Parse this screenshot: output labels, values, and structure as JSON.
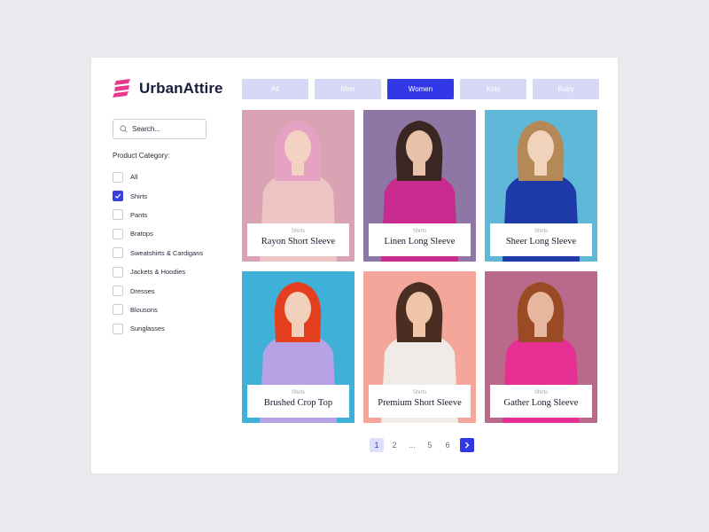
{
  "brand": {
    "name": "UrbanAttire",
    "accent": "#3238e6",
    "logo_color": "#e8398c"
  },
  "search": {
    "placeholder": "Search..."
  },
  "sidebar": {
    "category_title": "Product Category:",
    "categories": [
      {
        "label": "All",
        "checked": false
      },
      {
        "label": "Shirts",
        "checked": true
      },
      {
        "label": "Pants",
        "checked": false
      },
      {
        "label": "Bratops",
        "checked": false
      },
      {
        "label": "Sweatshirts & Cardigans",
        "checked": false
      },
      {
        "label": "Jackets & Hoodies",
        "checked": false
      },
      {
        "label": "Dresses",
        "checked": false
      },
      {
        "label": "Blousons",
        "checked": false
      },
      {
        "label": "Sunglasses",
        "checked": false
      }
    ]
  },
  "tabs": [
    {
      "label": "All",
      "active": false
    },
    {
      "label": "Men",
      "active": false
    },
    {
      "label": "Women",
      "active": true
    },
    {
      "label": "Kids",
      "active": false
    },
    {
      "label": "Baby",
      "active": false
    }
  ],
  "products": [
    {
      "category": "Shirts",
      "name": "Rayon Short Sleeve",
      "bg": "#d9a3b4",
      "shirt": "#eec3c3",
      "hair": "#e6a2c2",
      "skin": "#f3d2c4",
      "lower": "#e9d6d6"
    },
    {
      "category": "Shirts",
      "name": "Linen Long Sleeve",
      "bg": "#8e77a5",
      "shirt": "#c92a8e",
      "hair": "#3a2622",
      "skin": "#e7c2a8",
      "lower": "#c9d4df"
    },
    {
      "category": "Shirts",
      "name": "Sheer Long Sleeve",
      "bg": "#5fb8d8",
      "shirt": "#1d3aa8",
      "hair": "#b58858",
      "skin": "#f1d2ba",
      "lower": "#5a6e86"
    },
    {
      "category": "Shirts",
      "name": "Brushed Crop Top",
      "bg": "#3fb0d8",
      "shirt": "#b7a2e6",
      "hair": "#e4401f",
      "skin": "#f1d0bc",
      "lower": "#2c3a55"
    },
    {
      "category": "Shirts",
      "name": "Premium Short Sleeve",
      "bg": "#f4a69a",
      "shirt": "#f0ebe6",
      "hair": "#4a2e22",
      "skin": "#efc4a8",
      "lower": "#f39cbd"
    },
    {
      "category": "Shirts",
      "name": "Gather Long Sleeve",
      "bg": "#b96a8a",
      "shirt": "#e62f93",
      "hair": "#9a4b25",
      "skin": "#e8b79f",
      "lower": "#e8e4e4"
    }
  ],
  "pagination": {
    "pages": [
      "1",
      "2",
      "...",
      "5",
      "6"
    ],
    "current": "1"
  }
}
